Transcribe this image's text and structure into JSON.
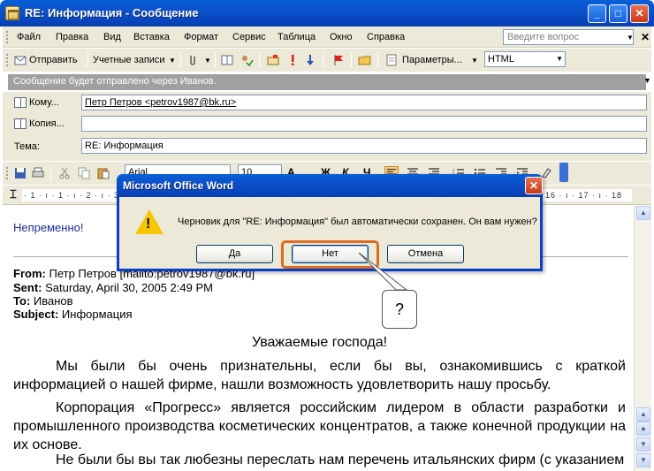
{
  "window": {
    "title": "RE: Информация - Сообщение",
    "controls": [
      "_",
      "□",
      "✕"
    ]
  },
  "menubar": {
    "items": [
      "Файл",
      "Правка",
      "Вид",
      "Вставка",
      "Формат",
      "Сервис",
      "Таблица",
      "Окно",
      "Справка"
    ],
    "search_placeholder": "Введите вопрос",
    "close_doc": "✕"
  },
  "toolbar": {
    "send_label": "Отправить",
    "accounts_label": "Учетные записи",
    "params_label": "Параметры...",
    "format_value": "HTML"
  },
  "infobar": {
    "text": "Сообщение будет отправлено через Иванов."
  },
  "header": {
    "to_label": "Кому...",
    "to_value": "Петр Петров <petrov1987@bk.ru>",
    "cc_label": "Копия...",
    "cc_value": "",
    "subject_label": "Тема:",
    "subject_value": "RE: Информация"
  },
  "format_toolbar": {
    "font": "Arial",
    "size": "10"
  },
  "ruler": {
    "left_marks": "· 1 · ı · 1 · ı · 2 · ı · 3",
    "right_marks": "16 · ı · 17 · ı · 18"
  },
  "document": {
    "reply": "Непременно!",
    "from_label": "From:",
    "from_value": "Петр Петров [mailto:petrov1987@bk.ru]",
    "sent_label": "Sent:",
    "sent_value": "Saturday, April 30, 2005 2:49 PM",
    "to_label": "To:",
    "to_value": "Иванов",
    "subject_label": "Subject:",
    "subject_value": "Информация",
    "greeting": "Уважаемые господа!",
    "para1": "Мы были бы очень признательны, если бы вы, ознакомившись с краткой информацией о нашей фирме, нашли возможность удовлетворить нашу просьбу.",
    "para2": "Корпорация «Прогресс» является российским лидером в области разработки и промышленного производства косметических концентратов, а также конечной продукции на их основе.",
    "para3": "Не были бы вы так любезны переслать нам перечень итальянских фирм (с указанием"
  },
  "dialog": {
    "title": "Microsoft Office Word",
    "message": "Черновик для \"RE: Информация\" был автоматически сохранен. Он вам нужен?",
    "yes_label": "Да",
    "no_label": "Нет",
    "cancel_label": "Отмена",
    "close": "✕",
    "icon": "warning-icon"
  },
  "callout": {
    "text": "?"
  },
  "colors": {
    "titlebar": "#0b4fc9",
    "reply_text": "#1d2c9b",
    "highlight": "#e06a1e",
    "infobar": "#a0a0a0"
  }
}
